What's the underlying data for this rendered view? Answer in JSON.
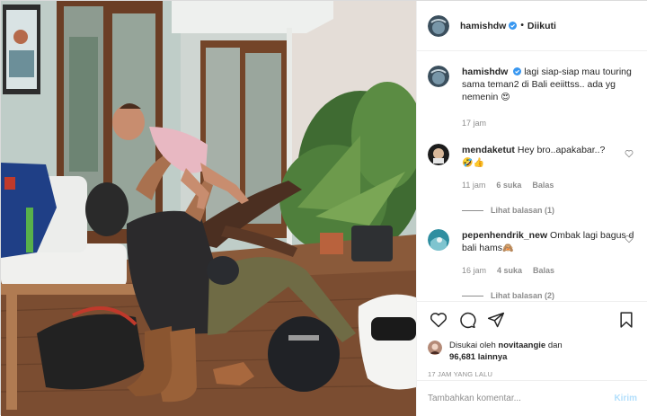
{
  "post": {
    "username": "hamishdw",
    "follow_status": "Diikuti",
    "separator": "•"
  },
  "caption": {
    "username": "hamishdw",
    "text": "lagi siap-siap mau touring sama teman2 di Bali eeiittss.. ada yg nemenin",
    "emoji": "😍",
    "time": "17 jam"
  },
  "comments": [
    {
      "username": "mendaketut",
      "text": "Hey bro..apakabar..?",
      "emoji": "🤣👍",
      "time": "11 jam",
      "likes": "6 suka",
      "reply": "Balas",
      "replies": "Lihat balasan (1)"
    },
    {
      "username": "pepenhendrik_new",
      "text": "Ombak lagi bagus d bali hams",
      "emoji": "🙈",
      "time": "16 jam",
      "likes": "4 suka",
      "reply": "Balas",
      "replies": "Lihat balasan (2)"
    }
  ],
  "likes": {
    "prefix": "Disukai oleh",
    "user": "novitaangie",
    "conj": "dan",
    "count": "96,681 lainnya"
  },
  "timestamp": "17 JAM YANG LALU",
  "add_comment": {
    "placeholder": "Tambahkan komentar...",
    "post_label": "Kirim"
  },
  "icons": {
    "like": "heart-icon",
    "comment": "comment-icon",
    "share": "share-icon",
    "save": "bookmark-icon",
    "verified": "verified-badge-icon"
  },
  "colors": {
    "verified": "#3897f0",
    "post_disabled": "#b2dffc",
    "muted": "#8e8e8e",
    "text": "#262626"
  }
}
